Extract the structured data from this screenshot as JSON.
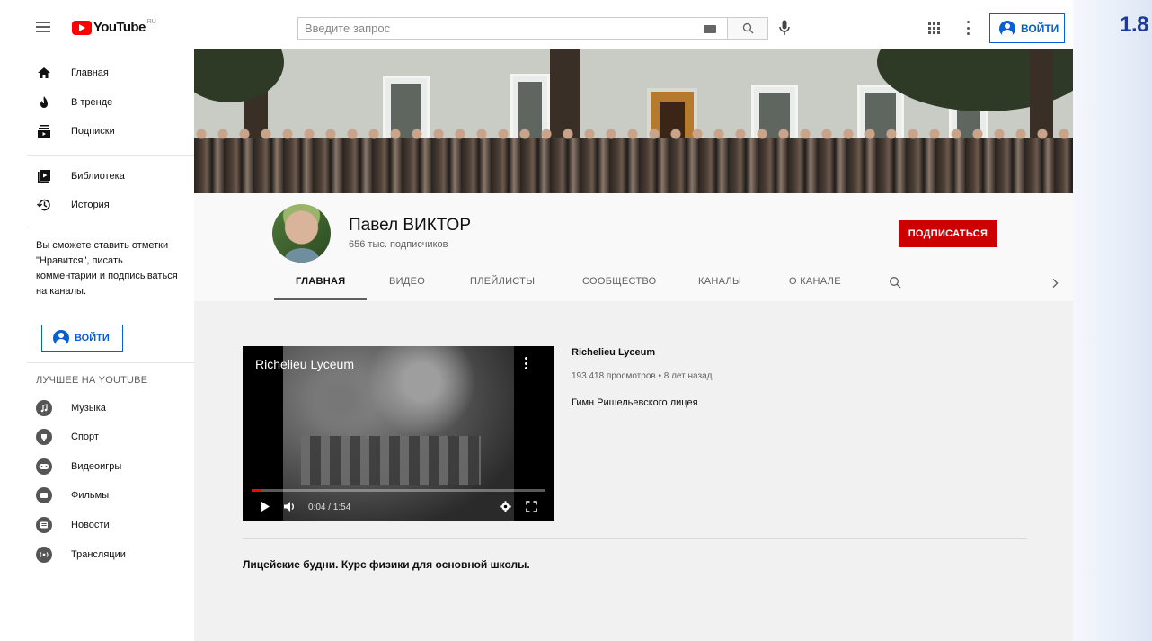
{
  "figure_number": "1.8",
  "header": {
    "logo_text": "YouTube",
    "logo_region": "RU",
    "search_placeholder": "Введите запрос",
    "signin_label": "ВОЙТИ"
  },
  "sidebar": {
    "main_items": [
      {
        "label": "Главная",
        "icon": "home-icon"
      },
      {
        "label": "В тренде",
        "icon": "trending-icon"
      },
      {
        "label": "Подписки",
        "icon": "subscriptions-icon"
      }
    ],
    "library_items": [
      {
        "label": "Библиотека",
        "icon": "library-icon"
      },
      {
        "label": "История",
        "icon": "history-icon"
      }
    ],
    "signin_note": "Вы сможете ставить отметки \"Нравится\", писать комментарии и подписываться на каналы.",
    "signin_label": "ВОЙТИ",
    "best_section_title": "ЛУЧШЕЕ НА YOUTUBE",
    "best_items": [
      {
        "label": "Музыка",
        "icon": "music-icon"
      },
      {
        "label": "Спорт",
        "icon": "sport-icon"
      },
      {
        "label": "Видеоигры",
        "icon": "gaming-icon"
      },
      {
        "label": "Фильмы",
        "icon": "movies-icon"
      },
      {
        "label": "Новости",
        "icon": "news-icon"
      },
      {
        "label": "Трансляции",
        "icon": "live-icon"
      }
    ]
  },
  "channel": {
    "name": "Павел ВИКТОР",
    "subscribers": "656 тыс. подписчиков",
    "subscribe_label": "ПОДПИСАТЬСЯ",
    "tabs": [
      "ГЛАВНАЯ",
      "ВИДЕО",
      "ПЛЕЙЛИСТЫ",
      "СООБЩЕСТВО",
      "КАНАЛЫ",
      "О КАНАЛЕ"
    ],
    "active_tab": "ГЛАВНАЯ"
  },
  "featured_video": {
    "player_title": "Richelieu Lyceum",
    "time": "0:04 / 1:54",
    "progress": 0.035,
    "title": "Richelieu Lyceum",
    "meta": "193 418 просмотров • 8 лет назад",
    "description": "Гимн Ришельевского лицея"
  },
  "shelf": {
    "title": "Лицейские будни. Курс физики для основной школы."
  },
  "colors": {
    "accent_blue": "#065fd4",
    "subscribe_red": "#cc0000",
    "logo_red": "#ff0000",
    "figure_number": "#1f3a93"
  }
}
